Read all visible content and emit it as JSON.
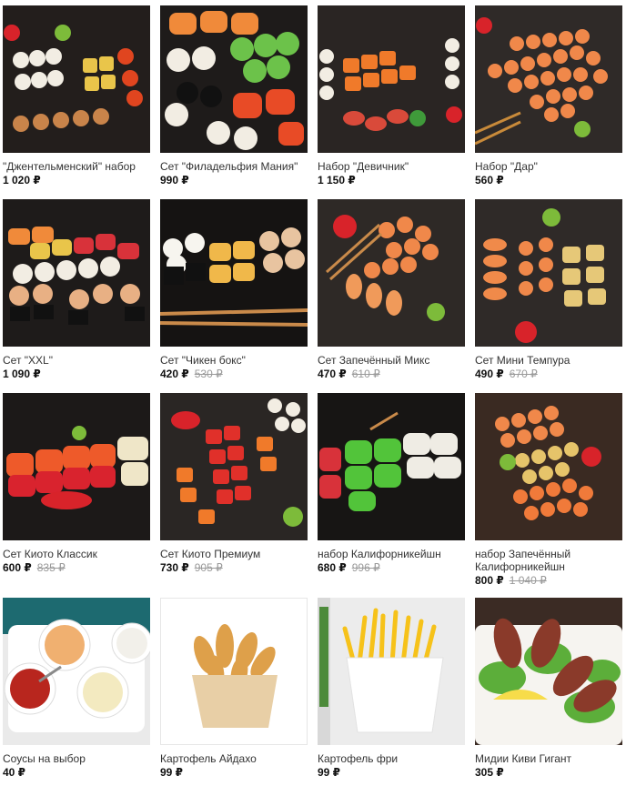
{
  "products": [
    {
      "name": "\"Джентельменский\" набор",
      "price": "1 020 ₽",
      "old_price": ""
    },
    {
      "name": "Сет \"Филадельфия Мания\"",
      "price": "990 ₽",
      "old_price": ""
    },
    {
      "name": "Набор \"Девичник\"",
      "price": "1 150 ₽",
      "old_price": ""
    },
    {
      "name": "Набор \"Дар\"",
      "price": "560 ₽",
      "old_price": ""
    },
    {
      "name": "Сет \"XXL\"",
      "price": "1 090 ₽",
      "old_price": ""
    },
    {
      "name": "Сет \"Чикен бокс\"",
      "price": "420 ₽",
      "old_price": "530 ₽"
    },
    {
      "name": "Сет Запечённый Микс",
      "price": "470 ₽",
      "old_price": "610 ₽"
    },
    {
      "name": "Сет Мини Темпура",
      "price": "490 ₽",
      "old_price": "670 ₽"
    },
    {
      "name": "Сет Киото Классик",
      "price": "600 ₽",
      "old_price": "835 ₽"
    },
    {
      "name": "Сет Киото Премиум",
      "price": "730 ₽",
      "old_price": "905 ₽"
    },
    {
      "name": "набор Калифорникейшн",
      "price": "680 ₽",
      "old_price": "996 ₽"
    },
    {
      "name": "набор Запечённый Калифорникейшн",
      "price": "800 ₽",
      "old_price": "1 040 ₽"
    },
    {
      "name": "Соусы на выбор",
      "price": "40 ₽",
      "old_price": ""
    },
    {
      "name": "Картофель Айдахо",
      "price": "99 ₽",
      "old_price": ""
    },
    {
      "name": "Картофель фри",
      "price": "99 ₽",
      "old_price": ""
    },
    {
      "name": "Мидии Киви Гигант",
      "price": "305 ₽",
      "old_price": ""
    }
  ]
}
